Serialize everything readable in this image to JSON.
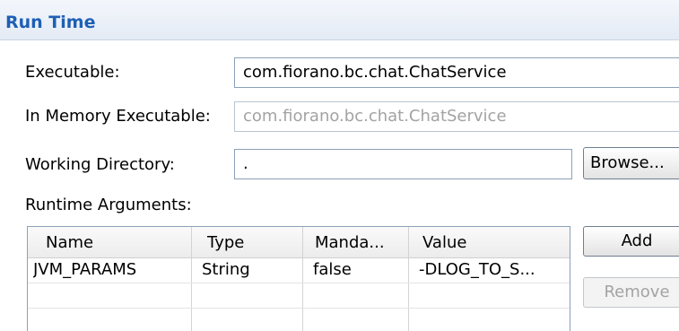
{
  "section": {
    "title": "Run Time"
  },
  "fields": {
    "executable": {
      "label": "Executable:",
      "value": "com.fiorano.bc.chat.ChatService"
    },
    "in_memory_executable": {
      "label": "In Memory Executable:",
      "value": "com.fiorano.bc.chat.ChatService"
    },
    "working_directory": {
      "label": "Working Directory:",
      "value": "."
    }
  },
  "buttons": {
    "browse": "Browse...",
    "add": "Add",
    "remove": "Remove"
  },
  "runtime_arguments": {
    "label": "Runtime Arguments:",
    "columns": [
      "Name",
      "Type",
      "Manda...",
      "Value"
    ],
    "rows": [
      [
        "JVM_PARAMS",
        "String",
        "false",
        "-DLOG_TO_S..."
      ]
    ]
  }
}
